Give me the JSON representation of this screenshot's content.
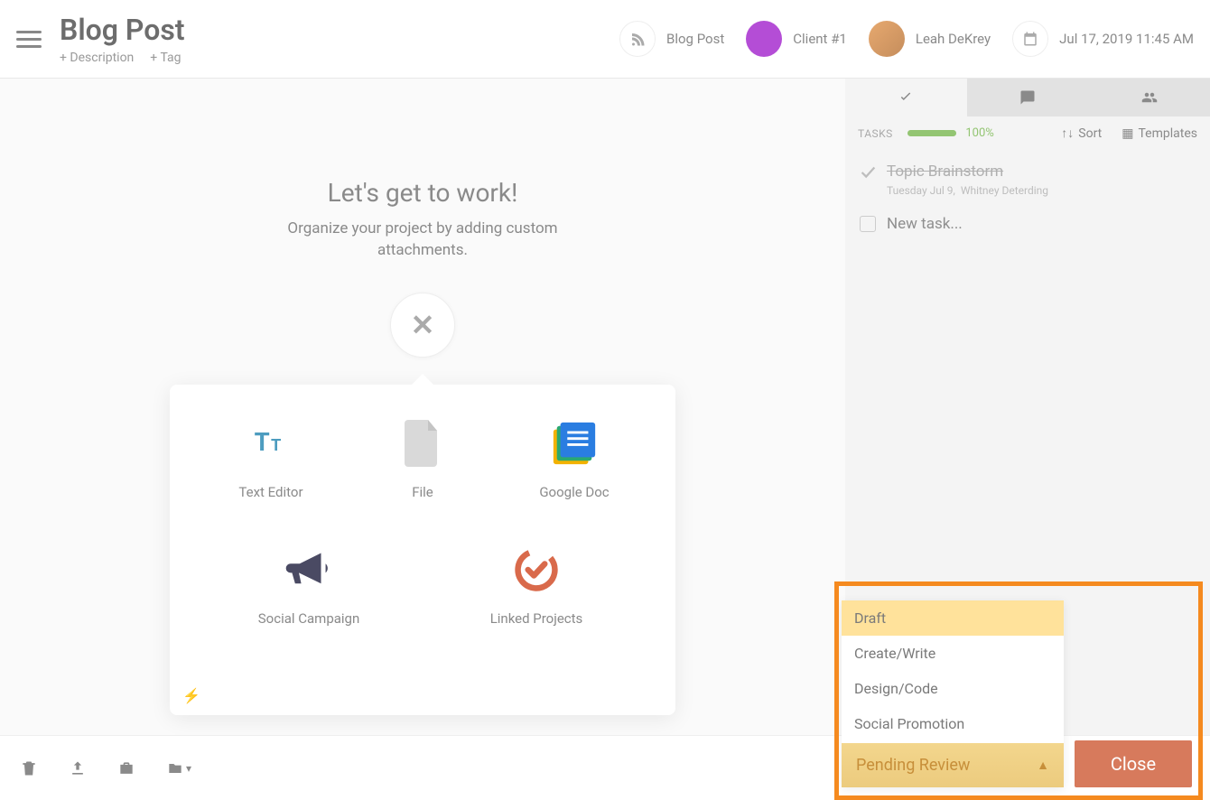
{
  "header": {
    "title": "Blog Post",
    "add_description": "+ Description",
    "add_tag": "+ Tag",
    "chips": {
      "blog_post": "Blog Post",
      "client": "Client #1",
      "owner": "Leah DeKrey",
      "date": "Jul 17, 2019 11:45 AM"
    }
  },
  "workspace": {
    "title": "Let's get to work!",
    "subtitle": "Organize your project by adding custom attachments.",
    "attachments": [
      {
        "id": "text-editor",
        "label": "Text Editor"
      },
      {
        "id": "file",
        "label": "File"
      },
      {
        "id": "google-doc",
        "label": "Google Doc"
      },
      {
        "id": "social",
        "label": "Social Campaign"
      },
      {
        "id": "linked",
        "label": "Linked Projects"
      }
    ]
  },
  "sidebar": {
    "tasks_label": "TASKS",
    "progress_pct": "100%",
    "sort_label": "Sort",
    "templates_label": "Templates",
    "tasks": [
      {
        "title": "Topic Brainstorm",
        "date": "Tuesday Jul 9,",
        "assignee": "Whitney Deterding",
        "done": true
      }
    ],
    "new_task": "New task..."
  },
  "status": {
    "options": [
      "Draft",
      "Create/Write",
      "Design/Code",
      "Social Promotion",
      "Pending Review"
    ],
    "active_index": 0,
    "current": "Pending Review",
    "close_label": "Close"
  }
}
